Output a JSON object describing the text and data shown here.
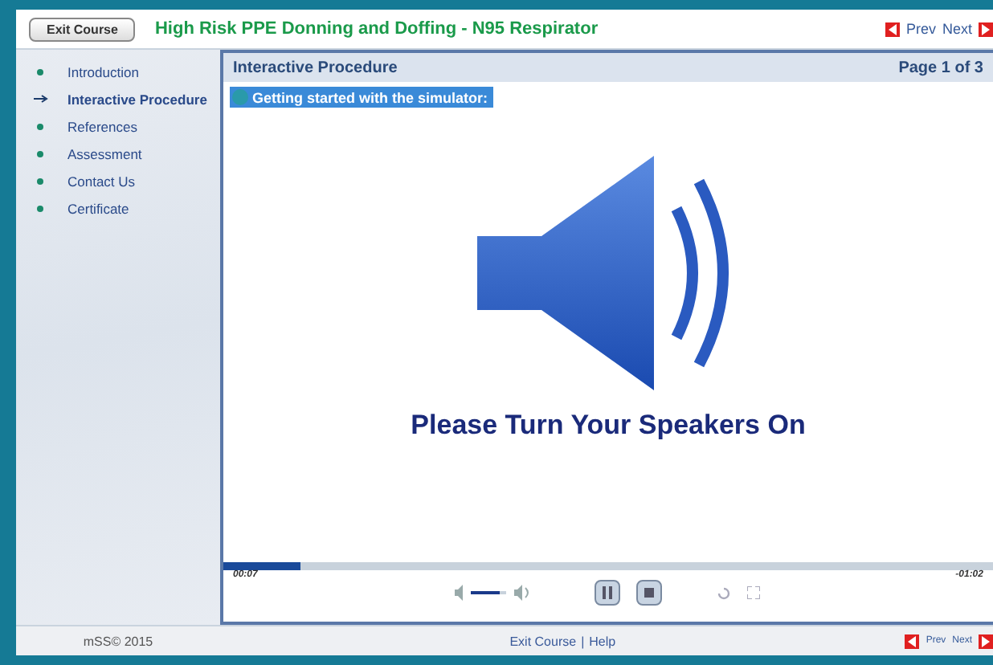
{
  "header": {
    "exit_button": "Exit Course",
    "title": "High Risk PPE Donning and Doffing - N95 Respirator",
    "prev": "Prev",
    "next": "Next"
  },
  "sidebar": {
    "items": [
      {
        "label": "Introduction",
        "selected": false
      },
      {
        "label": "Interactive Procedure",
        "selected": true
      },
      {
        "label": "References",
        "selected": false
      },
      {
        "label": "Assessment",
        "selected": false
      },
      {
        "label": "Contact Us",
        "selected": false
      },
      {
        "label": "Certificate",
        "selected": false
      }
    ]
  },
  "panel": {
    "title": "Interactive Procedure",
    "page": "Page 1 of 3"
  },
  "video": {
    "caption": "Getting started with the simulator:",
    "message": "Please Turn Your Speakers On",
    "progress": {
      "level": 0.1
    },
    "volume": {
      "level": 0.85
    },
    "elapsed": "00:07",
    "remaining": "-01:02"
  },
  "footer": {
    "copyright": "mSS© 2015",
    "links": [
      "Exit Course",
      "Help"
    ],
    "separator": "|",
    "prev": "Prev",
    "next": "Next"
  }
}
